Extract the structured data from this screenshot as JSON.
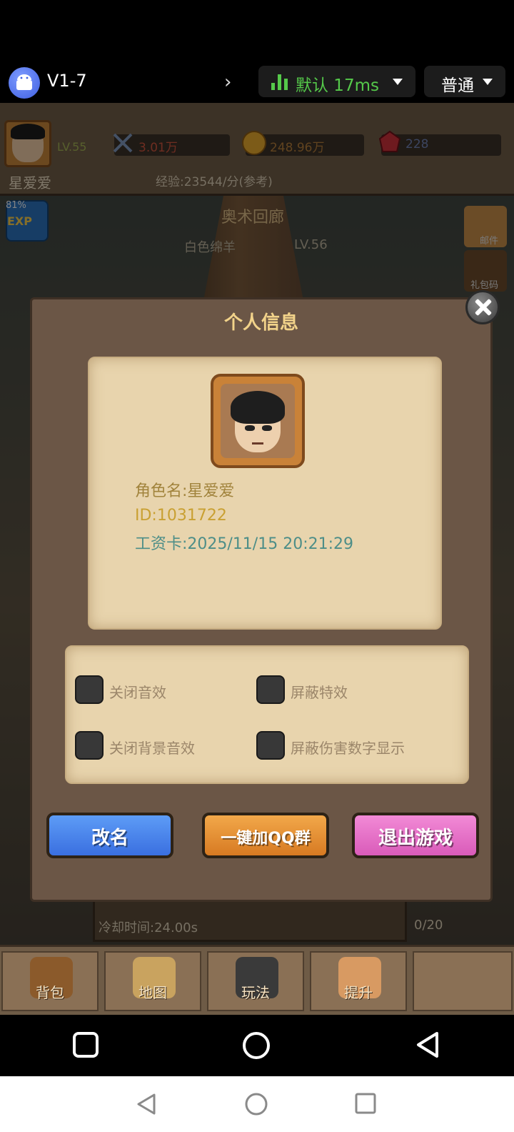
{
  "topbar": {
    "version": "V1-7",
    "network_label": "默认 17ms",
    "mode_label": "普通",
    "colors": {
      "network_green": "#55c94a"
    }
  },
  "player": {
    "level": "LV.55",
    "power": "3.01万",
    "gold": "248.96万",
    "gems": "228",
    "name": "星爱爱",
    "exp_rate": "经验:23544/分(参考)"
  },
  "scene": {
    "title": "奥术回廊",
    "monster": "白色绵羊",
    "monster_level": "LV.56",
    "exp_percent": "81%",
    "exp_badge": "EXP",
    "side_labels": [
      "邮件",
      "礼包码"
    ]
  },
  "dialog": {
    "title": "个人信息",
    "role_name": "角色名:星爱爱",
    "role_id": "ID:1031722",
    "wage_card": "工资卡:2025/11/15 20:21:29",
    "options": [
      {
        "label": "关闭音效",
        "checked": false
      },
      {
        "label": "屏蔽特效",
        "checked": false
      },
      {
        "label": "关闭背景音效",
        "checked": false
      },
      {
        "label": "屏蔽伤害数字显示",
        "checked": false
      }
    ],
    "buttons": {
      "rename": "改名",
      "join_qq": "一键加QQ群",
      "exit": "退出游戏"
    }
  },
  "behind": {
    "timer": "24秒",
    "cooldown": "冷却时间:24.00s",
    "count": "0/20"
  },
  "bottom_nav": [
    "背包",
    "地图",
    "玩法",
    "提升"
  ]
}
